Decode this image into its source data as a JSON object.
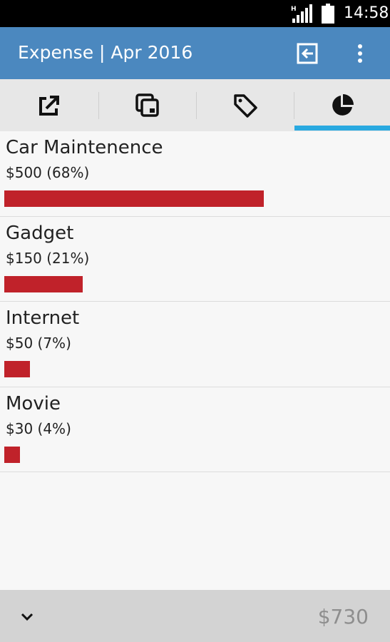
{
  "status_bar": {
    "time": "14:58",
    "network_label": "H",
    "icons": [
      "signal-icon",
      "battery-icon"
    ]
  },
  "app_bar": {
    "title": "Expense | Apr 2016",
    "actions": [
      "exit-to-app-icon",
      "more-vert-icon"
    ],
    "color": "#4b88bf"
  },
  "tabs": [
    {
      "icon": "share-external-icon",
      "selected": false
    },
    {
      "icon": "copy-pages-icon",
      "selected": false
    },
    {
      "icon": "tag-icon",
      "selected": false
    },
    {
      "icon": "pie-chart-icon",
      "selected": true
    }
  ],
  "accent_color": "#29a9e0",
  "bar_color": "#c0222a",
  "categories": [
    {
      "name": "Car Maintenence",
      "amount": "$500 (68%)",
      "share": 0.68
    },
    {
      "name": "Gadget",
      "amount": "$150 (21%)",
      "share": 0.205
    },
    {
      "name": "Internet",
      "amount": "$50 (7%)",
      "share": 0.068
    },
    {
      "name": "Movie",
      "amount": "$30 (4%)",
      "share": 0.041
    }
  ],
  "footer": {
    "total": "$730",
    "collapse_icon": "chevron-down-icon"
  }
}
